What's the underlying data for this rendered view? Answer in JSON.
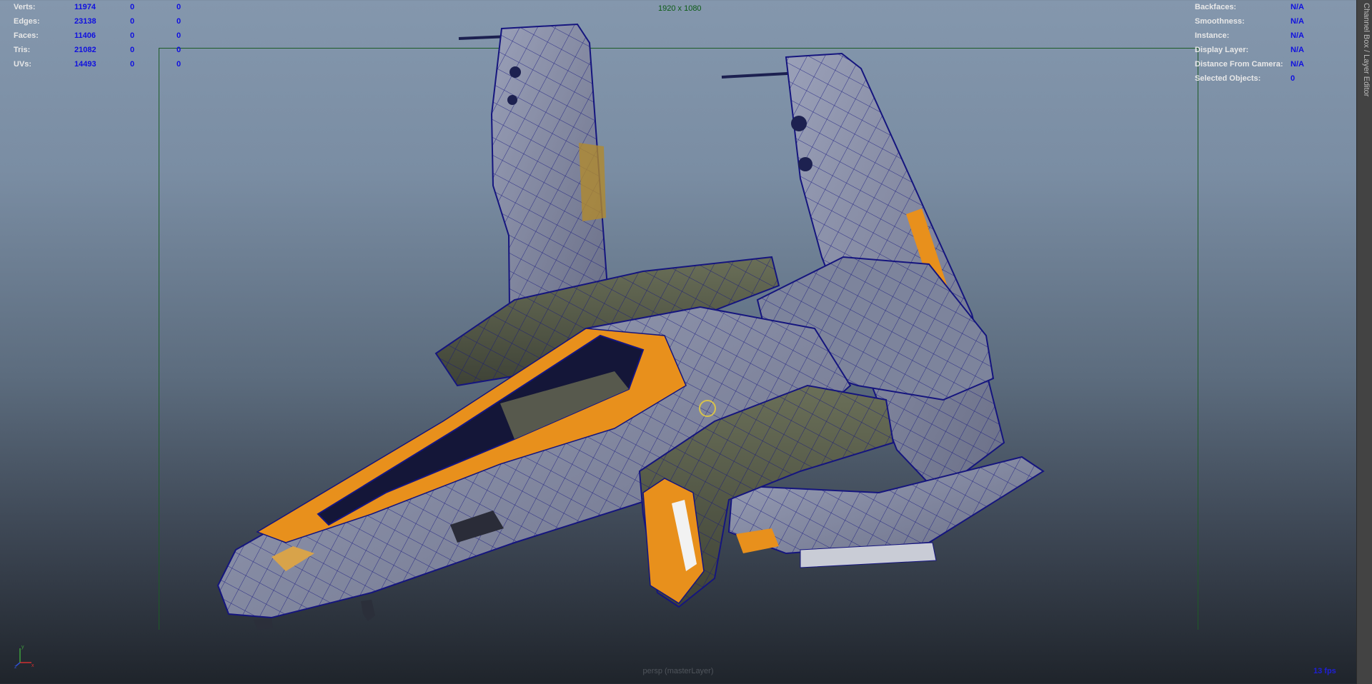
{
  "hud_left": [
    {
      "label": "Verts:",
      "v1": "11974",
      "v2": "0",
      "v3": "0"
    },
    {
      "label": "Edges:",
      "v1": "23138",
      "v2": "0",
      "v3": "0"
    },
    {
      "label": "Faces:",
      "v1": "11406",
      "v2": "0",
      "v3": "0"
    },
    {
      "label": "Tris:",
      "v1": "21082",
      "v2": "0",
      "v3": "0"
    },
    {
      "label": "UVs:",
      "v1": "14493",
      "v2": "0",
      "v3": "0"
    }
  ],
  "hud_right": [
    {
      "label": "Backfaces:",
      "value": "N/A"
    },
    {
      "label": "Smoothness:",
      "value": "N/A"
    },
    {
      "label": "Instance:",
      "value": "N/A"
    },
    {
      "label": "Display Layer:",
      "value": "N/A"
    },
    {
      "label": "Distance From Camera:",
      "value": "N/A"
    },
    {
      "label": "Selected Objects:",
      "value": "0"
    }
  ],
  "resolution": "1920 x 1080",
  "camera_label": "persp (masterLayer)",
  "fps": "13 fps",
  "side_tab": "Channel Box / Layer Editor",
  "colors": {
    "hud_value": "#1010e0",
    "resolution_gate": "#1d5b26",
    "hull": "#8a90a6",
    "accent": "#e8901c",
    "canopy": "#141638",
    "wire": "#15157e"
  }
}
